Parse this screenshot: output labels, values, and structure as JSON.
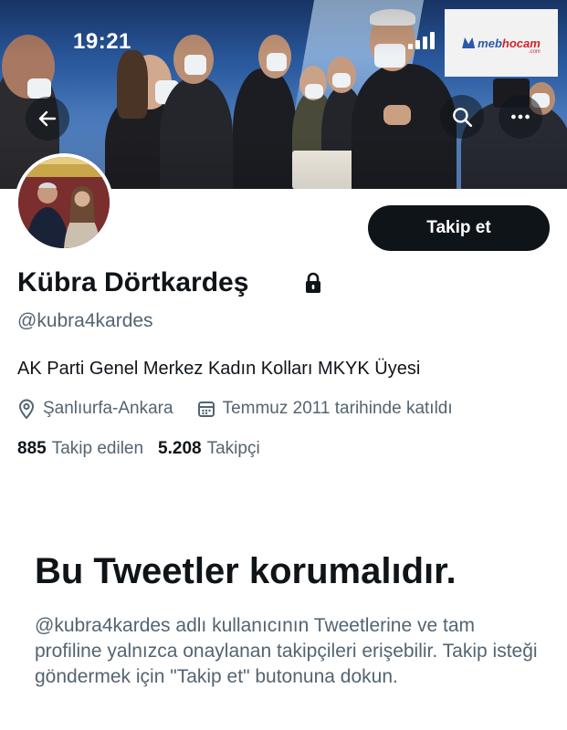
{
  "status_bar": {
    "time": "19:21"
  },
  "watermark": {
    "brand_main": "meb",
    "brand_accent": "hocam",
    "brand_sub": ".com"
  },
  "header_actions": {
    "back_icon": "arrow-left-icon",
    "search_icon": "search-icon",
    "more_icon": "more-horizontal-icon"
  },
  "profile": {
    "name": "Kübra Dörtkardeş",
    "handle": "@kubra4kardes",
    "bio": "AK Parti Genel Merkez Kadın Kolları MKYK Üyesi",
    "location": "Şanlıurfa-Ankara",
    "joined": "Temmuz 2011 tarihinde katıldı",
    "following_count": "885",
    "following_label": "Takip edilen",
    "followers_count": "5.208",
    "followers_label": "Takipçi",
    "follow_button": "Takip et"
  },
  "protected": {
    "title": "Bu Tweetler korumalıdır.",
    "description": "@kubra4kardes adlı kullanıcının Tweetlerine ve tam profiline yalnızca onaylanan takipçileri erişebilir. Takip isteği göndermek için \"Takip et\" butonuna dokun."
  },
  "colors": {
    "text_primary": "#0f1419",
    "text_secondary": "#536471",
    "button_bg": "#0f1419",
    "button_text": "#ffffff"
  }
}
